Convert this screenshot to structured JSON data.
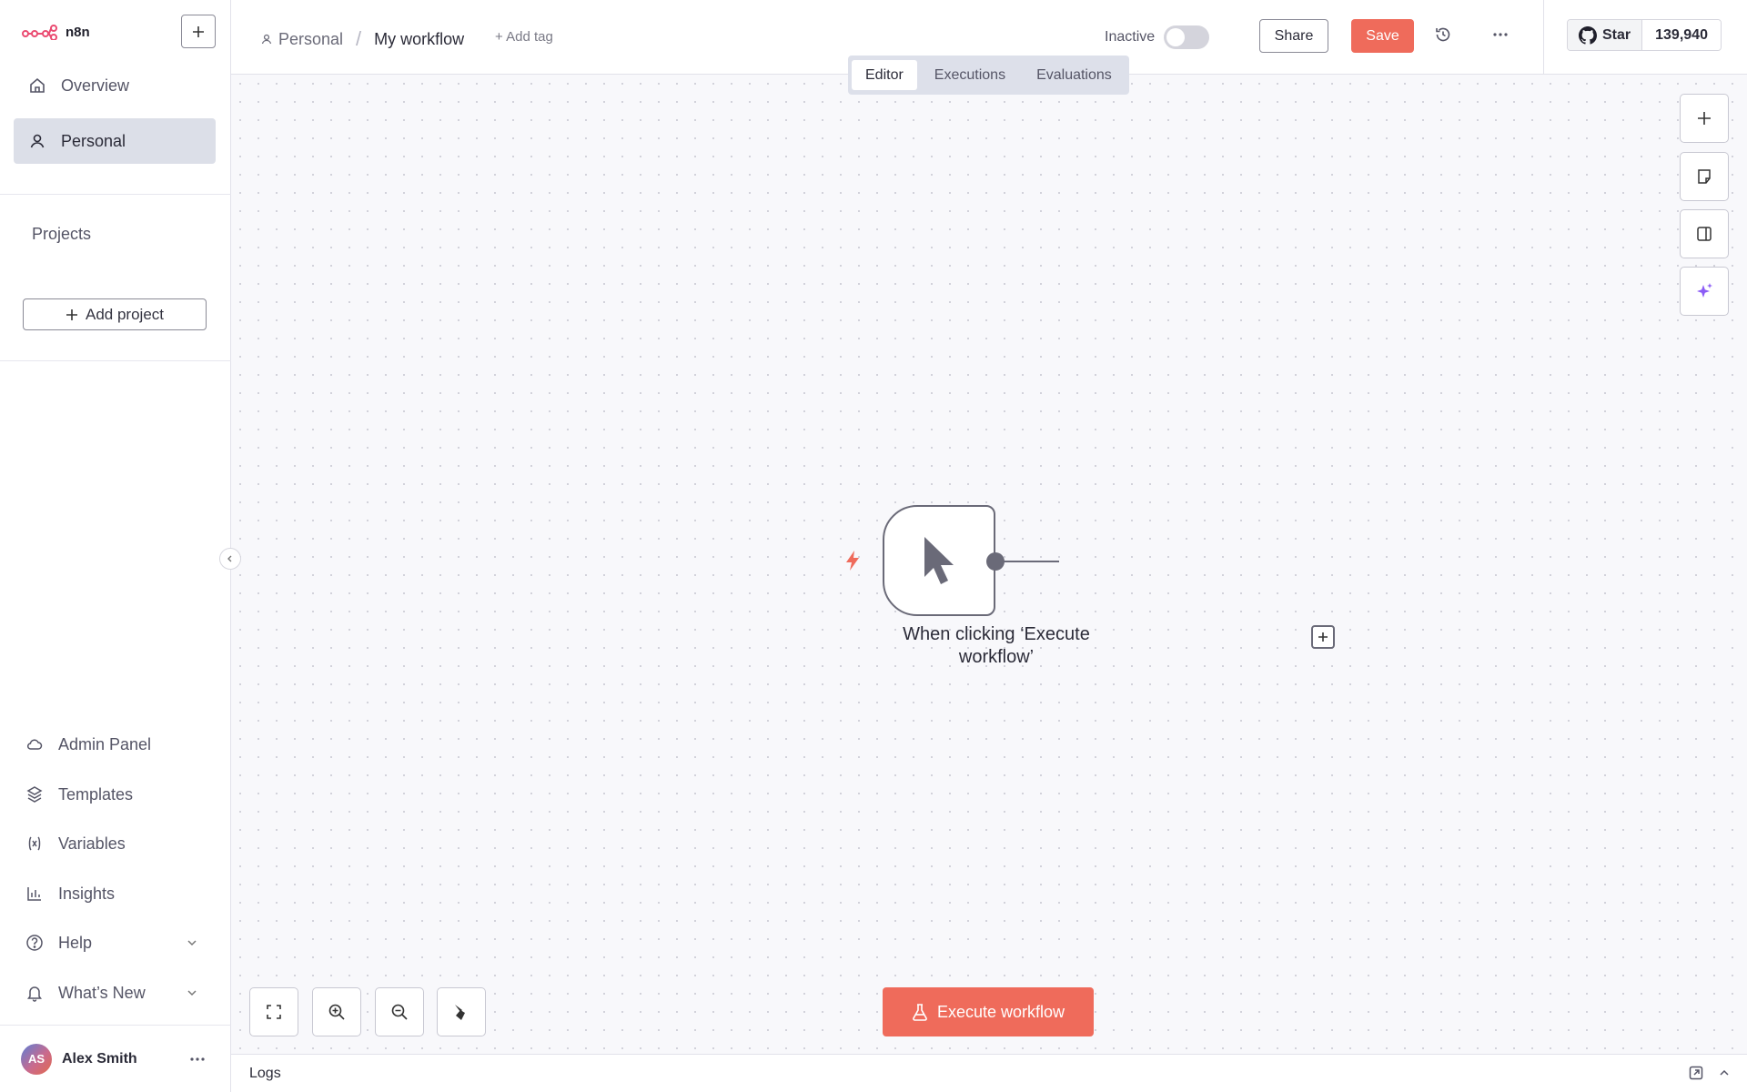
{
  "app": {
    "logo_text": "n8n",
    "accent": "#ef6b5b"
  },
  "sidebar": {
    "nav": [
      {
        "label": "Overview",
        "icon": "home-icon"
      },
      {
        "label": "Personal",
        "icon": "user-icon",
        "active": true
      }
    ],
    "projects_label": "Projects",
    "add_project_label": "Add project",
    "bottom": [
      {
        "label": "Admin Panel",
        "icon": "cloud-icon"
      },
      {
        "label": "Templates",
        "icon": "box-icon"
      },
      {
        "label": "Variables",
        "icon": "variables-icon"
      },
      {
        "label": "Insights",
        "icon": "chart-icon"
      },
      {
        "label": "Help",
        "icon": "help-icon"
      },
      {
        "label": "What’s New",
        "icon": "bell-icon"
      }
    ],
    "user": {
      "initials": "AS",
      "name": "Alex Smith"
    }
  },
  "header": {
    "breadcrumb_project": "Personal",
    "breadcrumb_separator": "/",
    "workflow_name": "My workflow",
    "add_tag": "+ Add tag",
    "status_label": "Inactive",
    "share_label": "Share",
    "save_label": "Save",
    "github": {
      "star_label": "Star",
      "count": "139,940"
    }
  },
  "tabs": [
    {
      "label": "Editor",
      "active": true
    },
    {
      "label": "Executions"
    },
    {
      "label": "Evaluations"
    }
  ],
  "canvas": {
    "node": {
      "label": "When clicking ‘Execute workflow’",
      "icon": "cursor-icon",
      "trigger_icon": "bolt-icon"
    },
    "execute_label": "Execute workflow"
  },
  "logs": {
    "label": "Logs"
  }
}
